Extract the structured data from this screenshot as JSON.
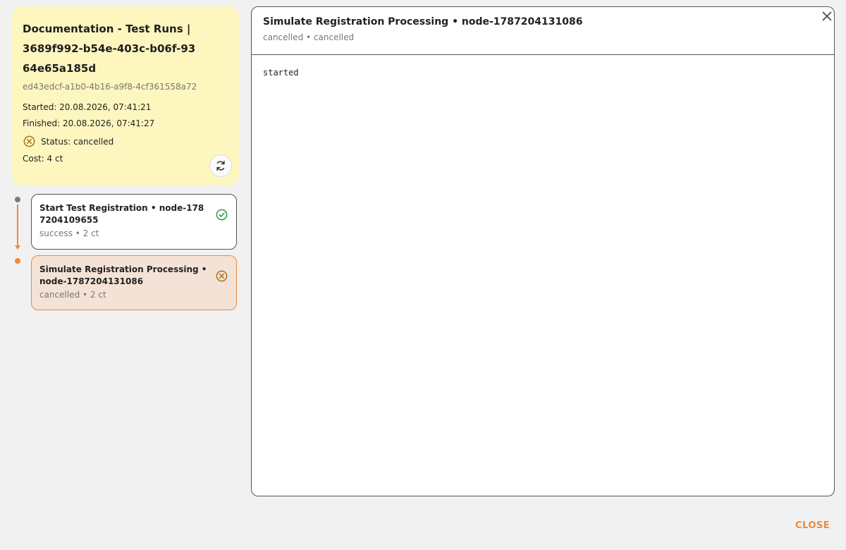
{
  "run": {
    "title": "Documentation - Test Runs | 3689f992-b54e-403c-b06f-9364e65a185d",
    "id": "ed43edcf-a1b0-4b16-a9f8-4cf361558a72",
    "started": "Started: 20.08.2026, 07:41:21",
    "finished": "Finished: 20.08.2026, 07:41:27",
    "status": "Status: cancelled",
    "cost": "Cost: 4 ct"
  },
  "nodes": [
    {
      "title": "Start Test Registration • node-1787204109655",
      "subtitle": "success • 2 ct",
      "status_icon": "check-circle-icon"
    },
    {
      "title": "Simulate Registration Processing • node-1787204131086",
      "subtitle": "cancelled • 2 ct",
      "status_icon": "x-circle-icon"
    }
  ],
  "detail": {
    "title": "Simulate Registration Processing • node-1787204131086",
    "subtitle": "cancelled • cancelled",
    "log": "started"
  },
  "actions": {
    "close_label": "CLOSE"
  },
  "colors": {
    "accent": "#ee8a3c",
    "summary_bg": "#fdf6bf",
    "selected_bg": "#f4e2d6",
    "success": "#2e9a44",
    "cancelled": "#a8741a"
  }
}
